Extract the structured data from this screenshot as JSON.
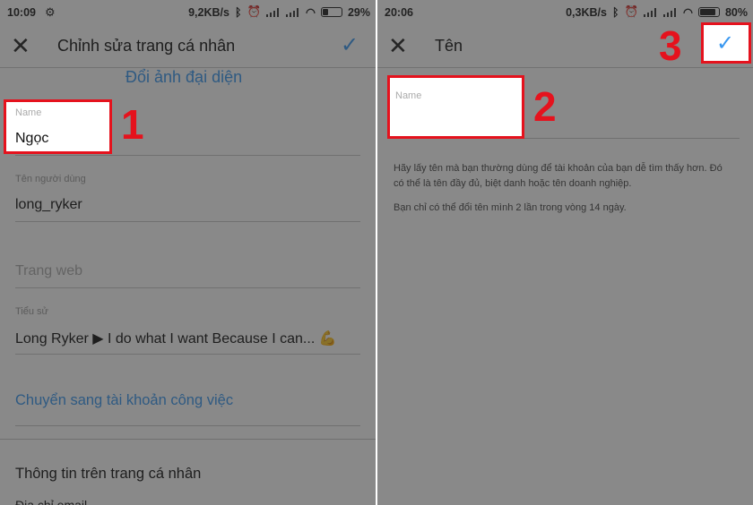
{
  "left": {
    "status": {
      "time": "10:09",
      "speed": "9,2KB/s",
      "battery": "29%"
    },
    "appbar": {
      "title": "Chỉnh sửa trang cá nhân"
    },
    "change_photo": "Đổi ảnh đại diện",
    "name_field": {
      "label": "Name",
      "value": "Ngọc"
    },
    "username_field": {
      "label": "Tên người dùng",
      "value": "long_ryker"
    },
    "website_field": {
      "placeholder": "Trang web"
    },
    "bio_field": {
      "label": "Tiểu sử",
      "value": "Long Ryker ▶ I do what I want Because I can... 💪"
    },
    "switch_link": "Chuyển sang tài khoản công việc",
    "profile_info": "Thông tin trên trang cá nhân",
    "cut_off": "Địa chỉ email",
    "step": "1"
  },
  "right": {
    "status": {
      "time": "20:06",
      "speed": "0,3KB/s",
      "battery": "80%"
    },
    "appbar": {
      "title": "Tên"
    },
    "name_field": {
      "label": "Name"
    },
    "hint1": "Hãy lấy tên mà bạn thường dùng để tài khoản của bạn dễ tìm thấy hơn. Đó có thể là tên đầy đủ, biệt danh hoặc tên doanh nghiệp.",
    "hint2": "Bạn chỉ có thể đổi tên mình 2 lần trong vòng 14 ngày.",
    "step2": "2",
    "step3": "3"
  },
  "colors": {
    "accent": "#3897f0",
    "highlight": "#e5121d"
  },
  "icons": [
    "close-icon",
    "check-icon",
    "settings-icon",
    "bluetooth-icon",
    "alarm-icon",
    "signal-icon",
    "wifi-icon",
    "battery-icon"
  ]
}
